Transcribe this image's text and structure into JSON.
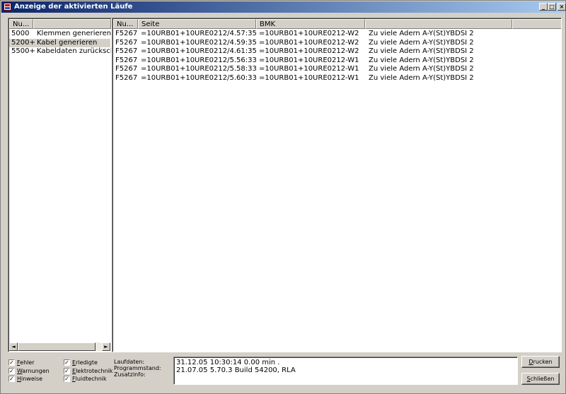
{
  "window": {
    "title": "Anzeige der aktivierten Läufe",
    "min_glyph": "_",
    "max_glyph": "□",
    "close_glyph": "×"
  },
  "runs_list": {
    "columns": [
      "Nu...",
      ""
    ],
    "items": [
      {
        "nr": "5000",
        "label": "Klemmen generieren",
        "selected": false
      },
      {
        "nr": "5200+",
        "label": "Kabel generieren",
        "selected": true
      },
      {
        "nr": "5500+",
        "label": "Kabeldaten zurückschreiben",
        "selected": false
      }
    ],
    "scroll_left_glyph": "◄",
    "scroll_right_glyph": "►"
  },
  "messages": {
    "columns": [
      "Nu...",
      "Seite",
      "BMK",
      ""
    ],
    "rows": [
      {
        "nr": "F5267",
        "seite": "=10URB01+10URE0212/4.57:35",
        "bmk": "=10URB01+10URE0212-W2",
        "text": "Zu viele Adern A-Y(St)YBDSI 2"
      },
      {
        "nr": "F5267",
        "seite": "=10URB01+10URE0212/4.59:35",
        "bmk": "=10URB01+10URE0212-W2",
        "text": "Zu viele Adern A-Y(St)YBDSI 2"
      },
      {
        "nr": "F5267",
        "seite": "=10URB01+10URE0212/4.61:35",
        "bmk": "=10URB01+10URE0212-W2",
        "text": "Zu viele Adern A-Y(St)YBDSI 2"
      },
      {
        "nr": "F5267",
        "seite": "=10URB01+10URE0212/5.56:33",
        "bmk": "=10URB01+10URE0212-W1",
        "text": "Zu viele Adern A-Y(St)YBDSI 2"
      },
      {
        "nr": "F5267",
        "seite": "=10URB01+10URE0212/5.58:33",
        "bmk": "=10URB01+10URE0212-W1",
        "text": "Zu viele Adern A-Y(St)YBDSI 2"
      },
      {
        "nr": "F5267",
        "seite": "=10URB01+10URE0212/5.60:33",
        "bmk": "=10URB01+10URE0212-W1",
        "text": "Zu viele Adern A-Y(St)YBDSI 2"
      }
    ]
  },
  "filters": {
    "checkmark": "✓",
    "fehler": {
      "label": "Fehler",
      "checked": true
    },
    "warnungen": {
      "label": "Warnungen",
      "checked": true
    },
    "hinweise": {
      "label": "Hinweise",
      "checked": true
    },
    "erledigte": {
      "label": "Erledigte",
      "checked": true
    },
    "elektrotechnik": {
      "label": "Elektrotechnik",
      "checked": true
    },
    "fluidtechnik": {
      "label": "Fluidtechnik",
      "checked": true
    }
  },
  "info": {
    "laufdaten_label": "Laufdaten:",
    "programmstand_label": "Programmstand:",
    "zusatzinfo_label": "Zusatzinfo:",
    "laufdaten_value": "31.12.05 10:30:14  0.00 min .",
    "programmstand_value": "21.07.05 5.70.3 Build 54200, RLA"
  },
  "buttons": {
    "drucken": "Drucken",
    "schliessen": "Schließen"
  }
}
